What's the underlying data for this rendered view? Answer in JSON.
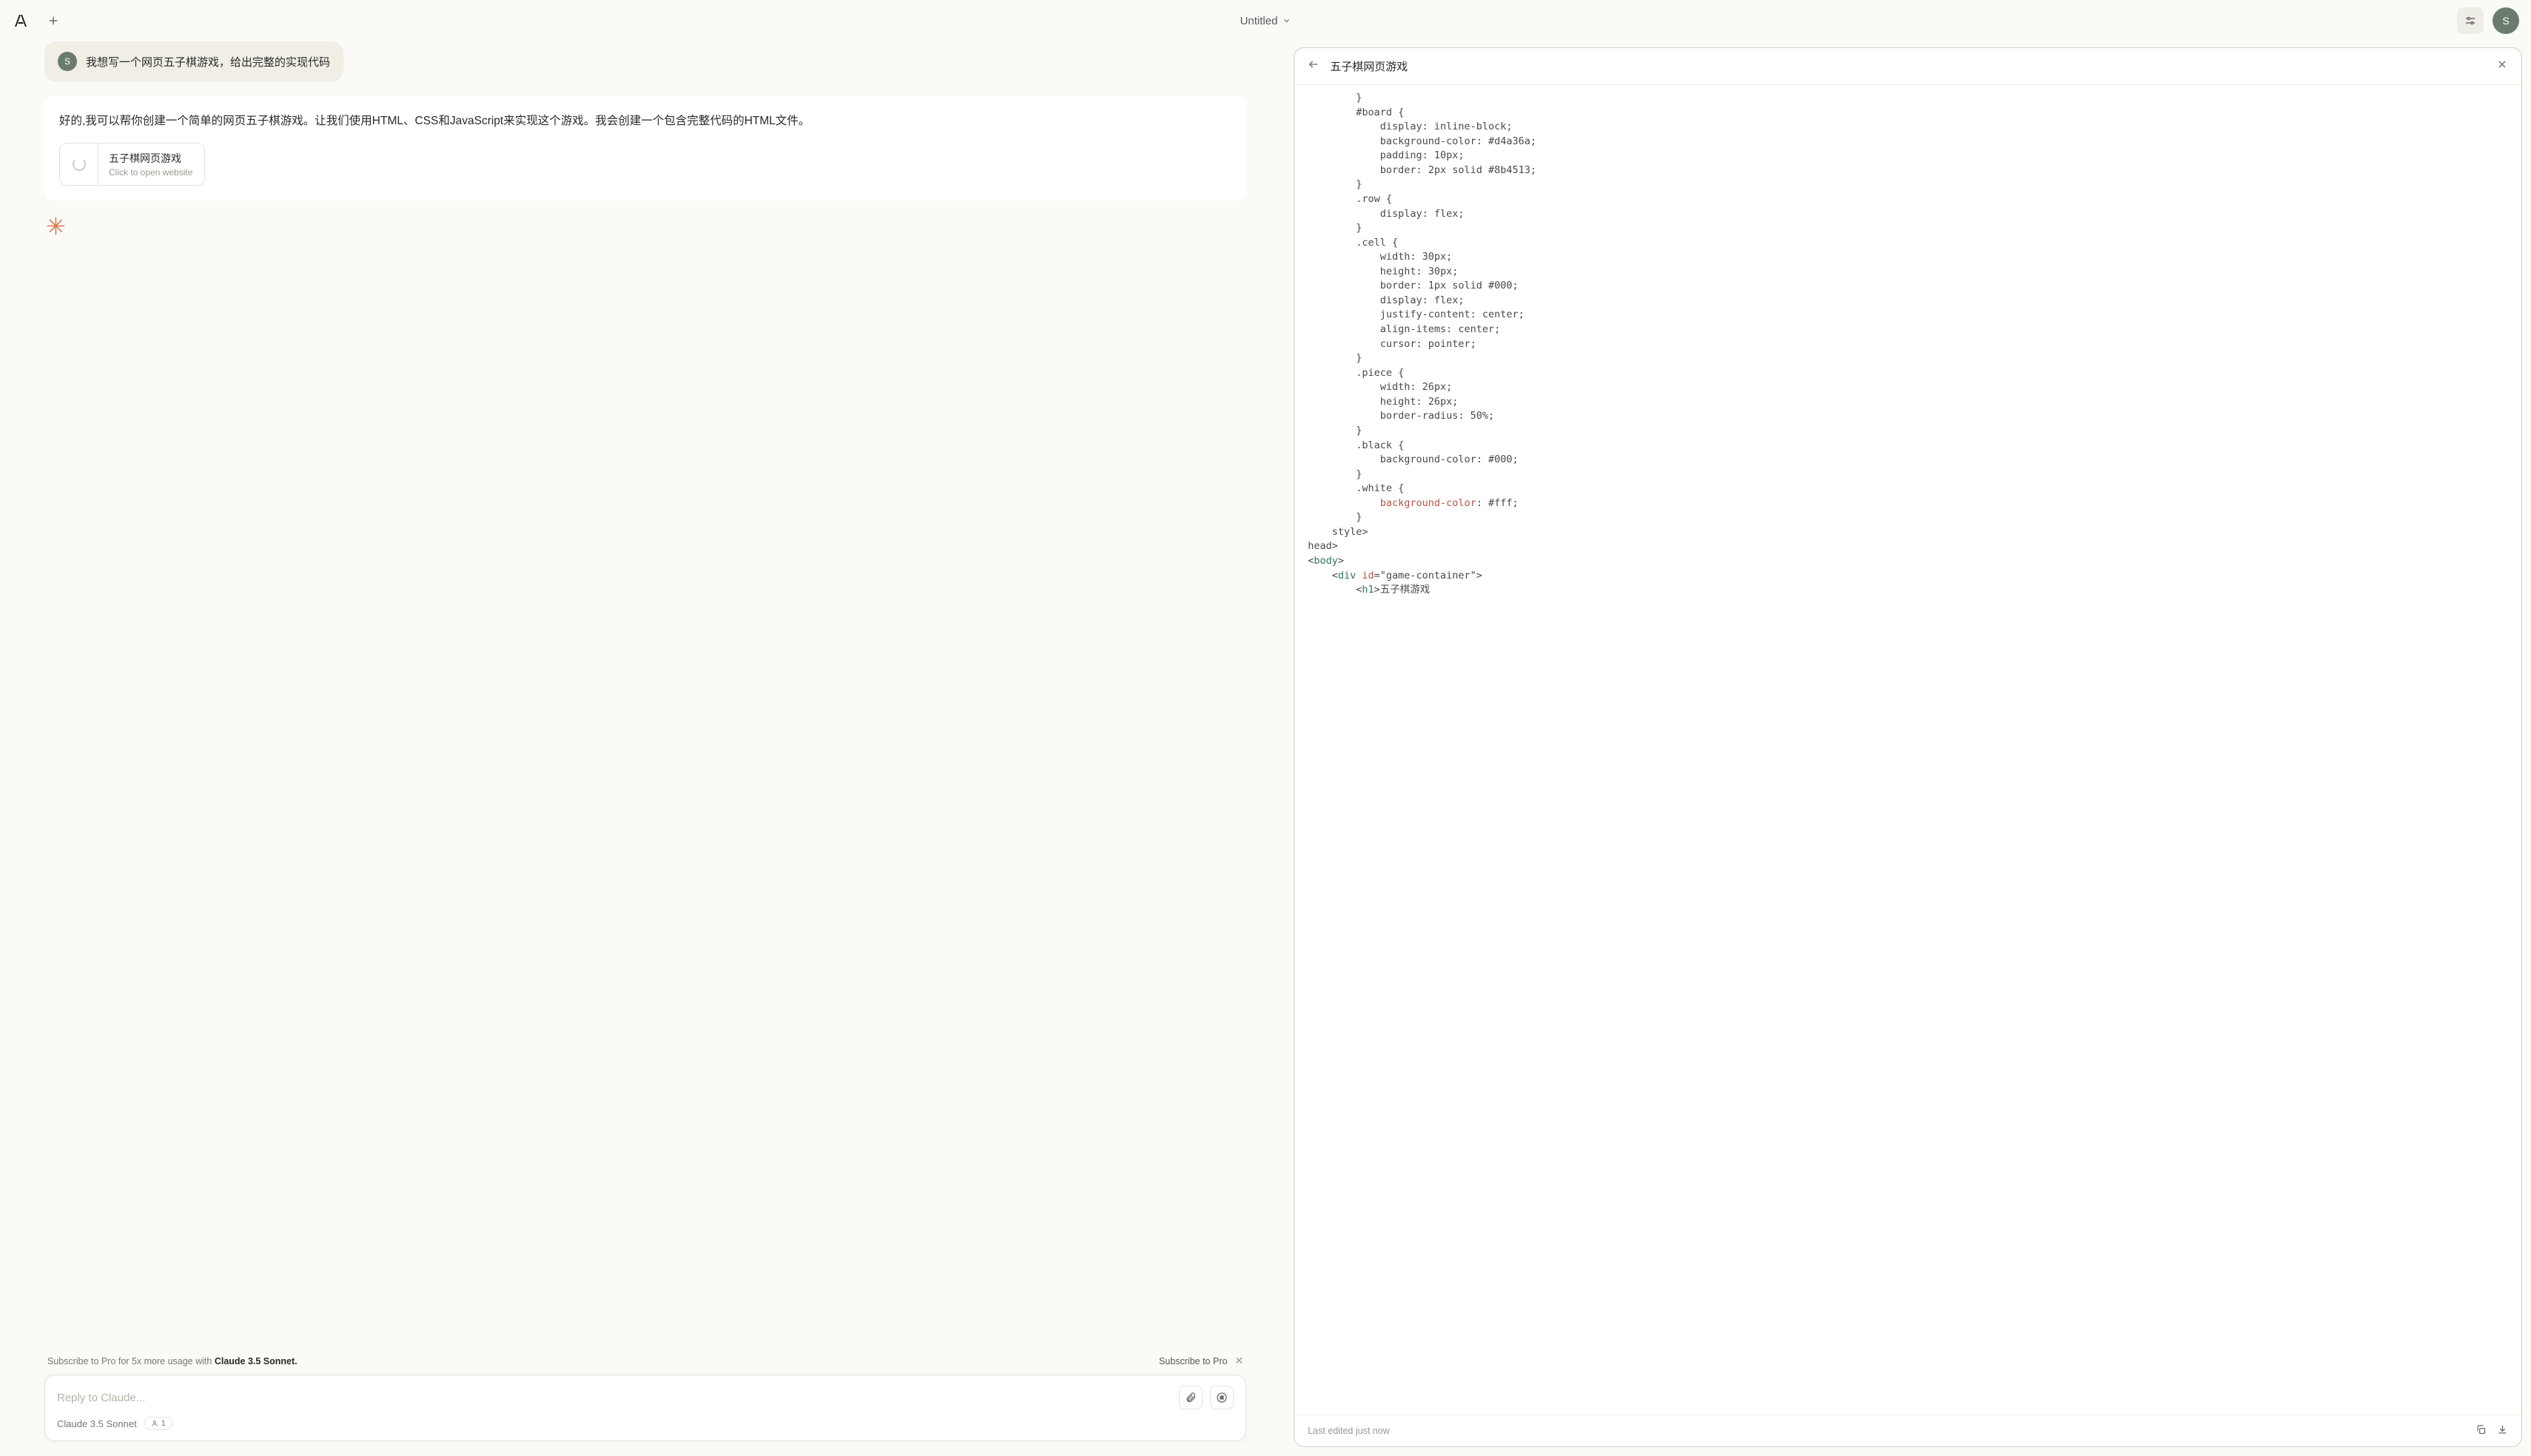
{
  "header": {
    "title": "Untitled",
    "avatar_letter": "S"
  },
  "conversation": {
    "user_avatar_letter": "S",
    "user_message": "我想写一个网页五子棋游戏，给出完整的实现代码",
    "assistant_message": "好的,我可以帮你创建一个简单的网页五子棋游戏。让我们使用HTML、CSS和JavaScript来实现这个游戏。我会创建一个包含完整代码的HTML文件。",
    "artifact": {
      "title": "五子棋网页游戏",
      "subtitle": "Click to open website"
    }
  },
  "subscribe": {
    "prefix": "Subscribe to Pro for 5x more usage with ",
    "bold": "Claude 3.5 Sonnet.",
    "cta": "Subscribe to Pro"
  },
  "input": {
    "placeholder": "Reply to Claude...",
    "model_prefix": "Claude ",
    "model_name": "3.5 Sonnet",
    "file_count": "1"
  },
  "code_panel": {
    "title": "五子棋网页游戏",
    "footer_status": "Last edited just now"
  },
  "code_lines": [
    {
      "indent": 8,
      "segments": [
        {
          "t": "}",
          "c": ""
        }
      ]
    },
    {
      "indent": 8,
      "segments": [
        {
          "t": "#board {",
          "c": ""
        }
      ]
    },
    {
      "indent": 12,
      "segments": [
        {
          "t": "display: inline-block;",
          "c": ""
        }
      ]
    },
    {
      "indent": 12,
      "segments": [
        {
          "t": "background-color: #d4a36a;",
          "c": ""
        }
      ]
    },
    {
      "indent": 12,
      "segments": [
        {
          "t": "padding: 10px;",
          "c": ""
        }
      ]
    },
    {
      "indent": 12,
      "segments": [
        {
          "t": "border: 2px solid #8b4513;",
          "c": ""
        }
      ]
    },
    {
      "indent": 8,
      "segments": [
        {
          "t": "}",
          "c": ""
        }
      ]
    },
    {
      "indent": 8,
      "segments": [
        {
          "t": ".row {",
          "c": ""
        }
      ]
    },
    {
      "indent": 12,
      "segments": [
        {
          "t": "display: flex;",
          "c": ""
        }
      ]
    },
    {
      "indent": 8,
      "segments": [
        {
          "t": "}",
          "c": ""
        }
      ]
    },
    {
      "indent": 8,
      "segments": [
        {
          "t": ".cell {",
          "c": ""
        }
      ]
    },
    {
      "indent": 12,
      "segments": [
        {
          "t": "width: 30px;",
          "c": ""
        }
      ]
    },
    {
      "indent": 12,
      "segments": [
        {
          "t": "height: 30px;",
          "c": ""
        }
      ]
    },
    {
      "indent": 12,
      "segments": [
        {
          "t": "border: 1px solid #000;",
          "c": ""
        }
      ]
    },
    {
      "indent": 12,
      "segments": [
        {
          "t": "display: flex;",
          "c": ""
        }
      ]
    },
    {
      "indent": 12,
      "segments": [
        {
          "t": "justify-content: center;",
          "c": ""
        }
      ]
    },
    {
      "indent": 12,
      "segments": [
        {
          "t": "align-items: center;",
          "c": ""
        }
      ]
    },
    {
      "indent": 12,
      "segments": [
        {
          "t": "cursor: pointer;",
          "c": ""
        }
      ]
    },
    {
      "indent": 8,
      "segments": [
        {
          "t": "}",
          "c": ""
        }
      ]
    },
    {
      "indent": 8,
      "segments": [
        {
          "t": ".piece {",
          "c": ""
        }
      ]
    },
    {
      "indent": 12,
      "segments": [
        {
          "t": "width: 26px;",
          "c": ""
        }
      ]
    },
    {
      "indent": 12,
      "segments": [
        {
          "t": "height: 26px;",
          "c": ""
        }
      ]
    },
    {
      "indent": 12,
      "segments": [
        {
          "t": "border-radius: 50%;",
          "c": ""
        }
      ]
    },
    {
      "indent": 8,
      "segments": [
        {
          "t": "}",
          "c": ""
        }
      ]
    },
    {
      "indent": 8,
      "segments": [
        {
          "t": ".black {",
          "c": ""
        }
      ]
    },
    {
      "indent": 12,
      "segments": [
        {
          "t": "background-color: #000;",
          "c": ""
        }
      ]
    },
    {
      "indent": 8,
      "segments": [
        {
          "t": "}",
          "c": ""
        }
      ]
    },
    {
      "indent": 8,
      "segments": [
        {
          "t": ".white {",
          "c": ""
        }
      ]
    },
    {
      "indent": 12,
      "segments": [
        {
          "t": "background-color",
          "c": "attr"
        },
        {
          "t": ": #fff;",
          "c": ""
        }
      ]
    },
    {
      "indent": 8,
      "segments": [
        {
          "t": "}",
          "c": ""
        }
      ]
    },
    {
      "indent": 4,
      "segments": [
        {
          "t": "</",
          "c": ""
        },
        {
          "t": "style",
          "c": "tag"
        },
        {
          "t": ">",
          "c": ""
        }
      ]
    },
    {
      "indent": 0,
      "segments": [
        {
          "t": "</",
          "c": ""
        },
        {
          "t": "head",
          "c": "tag"
        },
        {
          "t": ">",
          "c": ""
        }
      ]
    },
    {
      "indent": 0,
      "segments": [
        {
          "t": "<",
          "c": ""
        },
        {
          "t": "body",
          "c": "tag"
        },
        {
          "t": ">",
          "c": ""
        }
      ]
    },
    {
      "indent": 4,
      "segments": [
        {
          "t": "<",
          "c": ""
        },
        {
          "t": "div",
          "c": "tag"
        },
        {
          "t": " ",
          "c": ""
        },
        {
          "t": "id",
          "c": "attr"
        },
        {
          "t": "=\"game-container\">",
          "c": ""
        }
      ]
    },
    {
      "indent": 8,
      "segments": [
        {
          "t": "<",
          "c": ""
        },
        {
          "t": "h1",
          "c": "tag"
        },
        {
          "t": ">五子棋游戏",
          "c": ""
        }
      ]
    }
  ]
}
